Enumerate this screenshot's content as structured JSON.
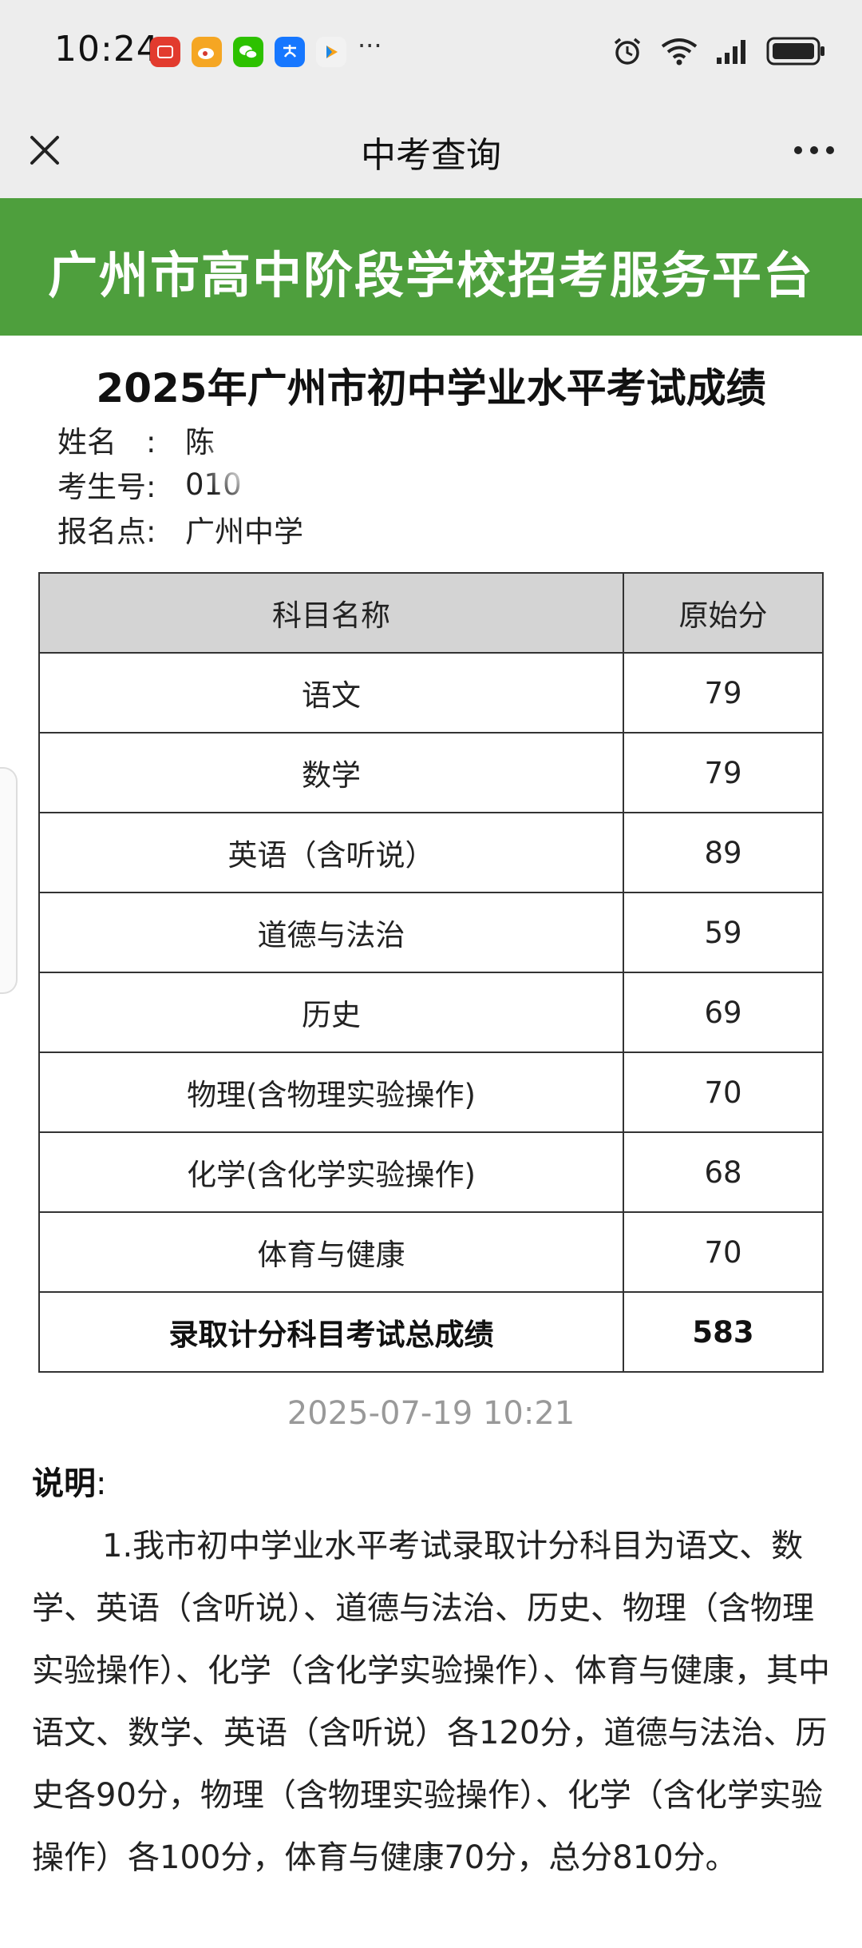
{
  "status_bar": {
    "time": "10:24",
    "apps": [
      {
        "icon": "huawei-store-icon",
        "color": "#e23b2e"
      },
      {
        "icon": "weibo-icon",
        "color": "#f5a623"
      },
      {
        "icon": "wechat-icon",
        "color": "#2dc100"
      },
      {
        "icon": "alipay-icon",
        "color": "#1677ff"
      },
      {
        "icon": "video-app-icon",
        "color": "#f2f2f2"
      }
    ],
    "more": "···"
  },
  "nav": {
    "title": "中考查询"
  },
  "banner": {
    "title": "广州市高中阶段学校招考服务平台",
    "color": "#4e9f3d"
  },
  "page": {
    "title": "2025年广州市初中学业水平考试成绩",
    "info": [
      {
        "label": "姓名　:",
        "value": "陈"
      },
      {
        "label": "考生号:",
        "value": "010"
      },
      {
        "label": "报名点:",
        "value": "广州中学"
      }
    ]
  },
  "table": {
    "headers": [
      "科目名称",
      "原始分"
    ],
    "rows": [
      {
        "subject": "语文",
        "score": "79"
      },
      {
        "subject": "数学",
        "score": "79"
      },
      {
        "subject": "英语（含听说）",
        "score": "89"
      },
      {
        "subject": "道德与法治",
        "score": "59"
      },
      {
        "subject": "历史",
        "score": "69"
      },
      {
        "subject": "物理(含物理实验操作)",
        "score": "70"
      },
      {
        "subject": "化学(含化学实验操作)",
        "score": "68"
      },
      {
        "subject": "体育与健康",
        "score": "70"
      }
    ],
    "total": {
      "subject": "录取计分科目考试总成绩",
      "score": "583"
    }
  },
  "timestamp": "2025-07-19 10:21",
  "note": {
    "title": "说明",
    "colon": ":",
    "body": "1.我市初中学业水平考试录取计分科目为语文、数学、英语（含听说）、道德与法治、历史、物理（含物理实验操作）、化学（含化学实验操作）、体育与健康，其中语文、数学、英语（含听说）各120分，道德与法治、历史各90分，物理（含物理实验操作）、化学（含化学实验操作）各100分，体育与健康70分，总分810分。"
  }
}
